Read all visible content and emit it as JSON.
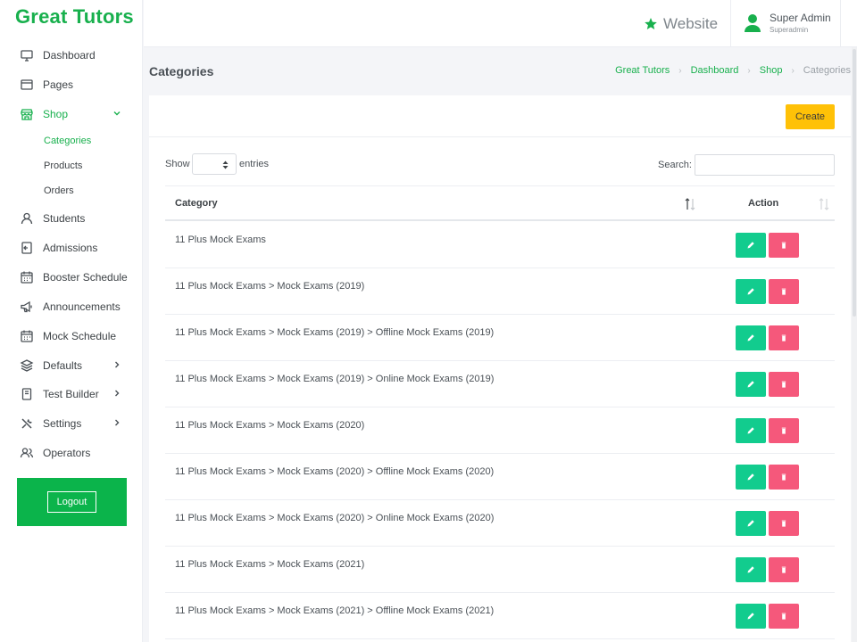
{
  "brand": "Great Tutors",
  "sidebar": {
    "items": [
      {
        "label": "Dashboard",
        "icon": "monitor-icon"
      },
      {
        "label": "Pages",
        "icon": "window-icon"
      },
      {
        "label": "Shop",
        "icon": "store-icon"
      },
      {
        "label": "Students",
        "icon": "user-icon"
      },
      {
        "label": "Admissions",
        "icon": "enter-icon"
      },
      {
        "label": "Booster Schedule",
        "icon": "calendar-icon"
      },
      {
        "label": "Announcements",
        "icon": "megaphone-icon"
      },
      {
        "label": "Mock Schedule",
        "icon": "calendar-icon"
      },
      {
        "label": "Defaults",
        "icon": "layers-icon"
      },
      {
        "label": "Test Builder",
        "icon": "book-icon"
      },
      {
        "label": "Settings",
        "icon": "tools-icon"
      },
      {
        "label": "Operators",
        "icon": "users-icon"
      }
    ],
    "shop_sub": [
      {
        "label": "Categories"
      },
      {
        "label": "Products"
      },
      {
        "label": "Orders"
      }
    ],
    "logout_label": "Logout"
  },
  "topbar": {
    "website_label": "Website",
    "user_name": "Super Admin",
    "user_role": "Superadmin"
  },
  "page": {
    "title": "Categories",
    "breadcrumb": [
      "Great Tutors",
      "Dashboard",
      "Shop",
      "Categories"
    ]
  },
  "table": {
    "create_label": "Create",
    "show_label": "Show",
    "entries_label": "entries",
    "search_label": "Search:",
    "search_value": "",
    "columns": [
      "Category",
      "Action"
    ],
    "rows": [
      "11 Plus Mock Exams",
      "11 Plus Mock Exams > Mock Exams (2019)",
      "11 Plus Mock Exams > Mock Exams (2019) > Offline Mock Exams (2019)",
      "11 Plus Mock Exams > Mock Exams (2019) > Online Mock Exams (2019)",
      "11 Plus Mock Exams > Mock Exams (2020)",
      "11 Plus Mock Exams > Mock Exams (2020) > Offline Mock Exams (2020)",
      "11 Plus Mock Exams > Mock Exams (2020) > Online Mock Exams (2020)",
      "11 Plus Mock Exams > Mock Exams (2021)",
      "11 Plus Mock Exams > Mock Exams (2021) > Offline Mock Exams (2021)"
    ]
  },
  "colors": {
    "brand_green": "#18b04d",
    "edit_green": "#12cc8e",
    "delete_red": "#f5587b",
    "create_yellow": "#ffc107"
  }
}
